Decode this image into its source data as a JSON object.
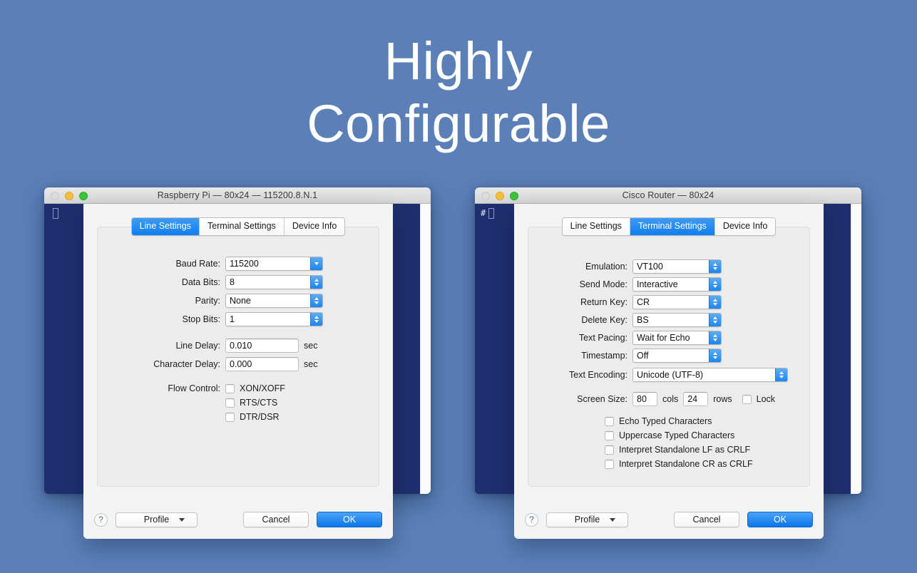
{
  "hero": {
    "line1": "Highly",
    "line2": "Configurable"
  },
  "colors": {
    "background": "#5b80b8",
    "terminal_bg": "#1f2e6e",
    "accent_blue": "#0f7ef0",
    "sheet_bg": "#f3f3f3"
  },
  "windows": [
    {
      "id": "raspberry-pi",
      "title": "Raspberry Pi — 80x24 — 115200.8.N.1",
      "terminal_prompt": "",
      "tabs": [
        {
          "label": "Line Settings",
          "active": true
        },
        {
          "label": "Terminal Settings",
          "active": false
        },
        {
          "label": "Device Info",
          "active": false
        }
      ],
      "fields": [
        {
          "label": "Baud Rate:",
          "value": "115200",
          "control": "popup"
        },
        {
          "label": "Data Bits:",
          "value": "8",
          "control": "stepper"
        },
        {
          "label": "Parity:",
          "value": "None",
          "control": "stepper"
        },
        {
          "label": "Stop Bits:",
          "value": "1",
          "control": "stepper"
        }
      ],
      "delays": [
        {
          "label": "Line Delay:",
          "value": "0.010",
          "unit": "sec"
        },
        {
          "label": "Character Delay:",
          "value": "0.000",
          "unit": "sec"
        }
      ],
      "flow_control_label": "Flow Control:",
      "flow_control": [
        {
          "label": "XON/XOFF",
          "checked": false
        },
        {
          "label": "RTS/CTS",
          "checked": false
        },
        {
          "label": "DTR/DSR",
          "checked": false
        }
      ],
      "footer": {
        "help": "?",
        "profile": "Profile",
        "cancel": "Cancel",
        "ok": "OK"
      }
    },
    {
      "id": "cisco-router",
      "title": "Cisco Router — 80x24",
      "terminal_prompt": "#",
      "tabs": [
        {
          "label": "Line Settings",
          "active": false
        },
        {
          "label": "Terminal Settings",
          "active": true
        },
        {
          "label": "Device Info",
          "active": false
        }
      ],
      "fields": [
        {
          "label": "Emulation:",
          "value": "VT100",
          "control": "stepper"
        },
        {
          "label": "Send Mode:",
          "value": "Interactive",
          "control": "stepper"
        },
        {
          "label": "Return Key:",
          "value": "CR",
          "control": "stepper"
        },
        {
          "label": "Delete Key:",
          "value": "BS",
          "control": "stepper"
        },
        {
          "label": "Text Pacing:",
          "value": "Wait for Echo",
          "control": "stepper"
        },
        {
          "label": "Timestamp:",
          "value": "Off",
          "control": "stepper"
        }
      ],
      "encoding": {
        "label": "Text Encoding:",
        "value": "Unicode (UTF-8)",
        "control": "stepper"
      },
      "screen_size": {
        "label": "Screen Size:",
        "cols_value": "80",
        "cols_unit": "cols",
        "rows_value": "24",
        "rows_unit": "rows",
        "lock_label": "Lock",
        "lock_checked": false
      },
      "options": [
        {
          "label": "Echo Typed Characters",
          "checked": false
        },
        {
          "label": "Uppercase Typed Characters",
          "checked": false
        },
        {
          "label": "Interpret Standalone LF as CRLF",
          "checked": false
        },
        {
          "label": "Interpret Standalone CR as CRLF",
          "checked": false
        }
      ],
      "footer": {
        "help": "?",
        "profile": "Profile",
        "cancel": "Cancel",
        "ok": "OK"
      }
    }
  ]
}
